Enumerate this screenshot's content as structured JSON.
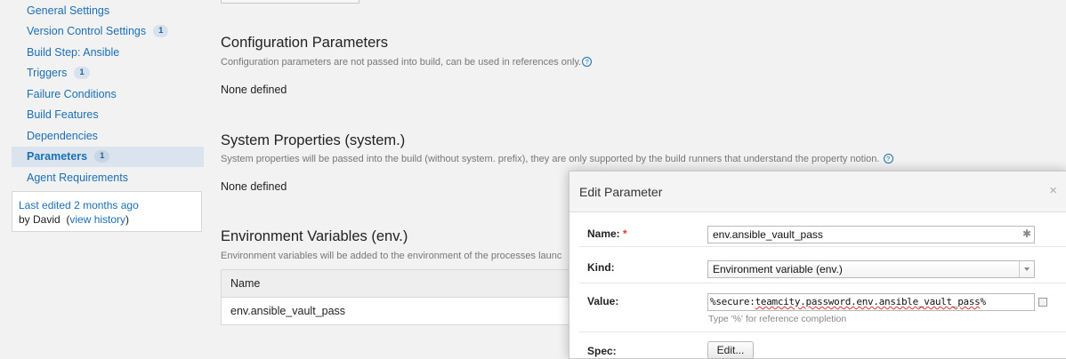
{
  "sidebar": {
    "items": [
      {
        "label": "General Settings",
        "badge": ""
      },
      {
        "label": "Version Control Settings",
        "badge": "1"
      },
      {
        "label": "Build Step: Ansible",
        "badge": ""
      },
      {
        "label": "Triggers",
        "badge": "1"
      },
      {
        "label": "Failure Conditions",
        "badge": ""
      },
      {
        "label": "Build Features",
        "badge": ""
      },
      {
        "label": "Dependencies",
        "badge": ""
      },
      {
        "label": "Parameters",
        "badge": "1"
      },
      {
        "label": "Agent Requirements",
        "badge": ""
      }
    ],
    "last_edited_label": "Last edited",
    "last_edited_time": "2 months ago",
    "by_label": "by David",
    "open_paren": "(",
    "view_history": "view history",
    "close_paren": ")"
  },
  "main": {
    "config": {
      "title": "Configuration Parameters",
      "desc": "Configuration parameters are not passed into build, can be used in references only.",
      "none": "None defined"
    },
    "system": {
      "title": "System Properties (system.)",
      "desc": "System properties will be passed into the build (without system. prefix), they are only supported by the build runners that understand the property notion.",
      "none": "None defined"
    },
    "env": {
      "title": "Environment Variables (env.)",
      "desc": "Environment variables will be added to the environment of the processes launc",
      "column": "Name",
      "rows": [
        "env.ansible_vault_pass"
      ]
    },
    "help_glyph": "?"
  },
  "dialog": {
    "title": "Edit Parameter",
    "close_glyph": "×",
    "name_label": "Name:",
    "required_mark": "*",
    "name_value": "env.ansible_vault_pass",
    "name_icon_glyph": "✱",
    "kind_label": "Kind:",
    "kind_value": "Environment variable (env.)",
    "value_label": "Value:",
    "value_prefix": "%secure:",
    "value_body": "teamcity.password.env.ansible_vault_pass",
    "value_suffix": "%",
    "value_hint": "Type '%' for reference completion",
    "spec_label": "Spec:",
    "spec_button": "Edit..."
  },
  "colors": {
    "link": "#1a6fb5",
    "active_nav_bg": "#dbe4ee",
    "required": "#d83a2a"
  }
}
